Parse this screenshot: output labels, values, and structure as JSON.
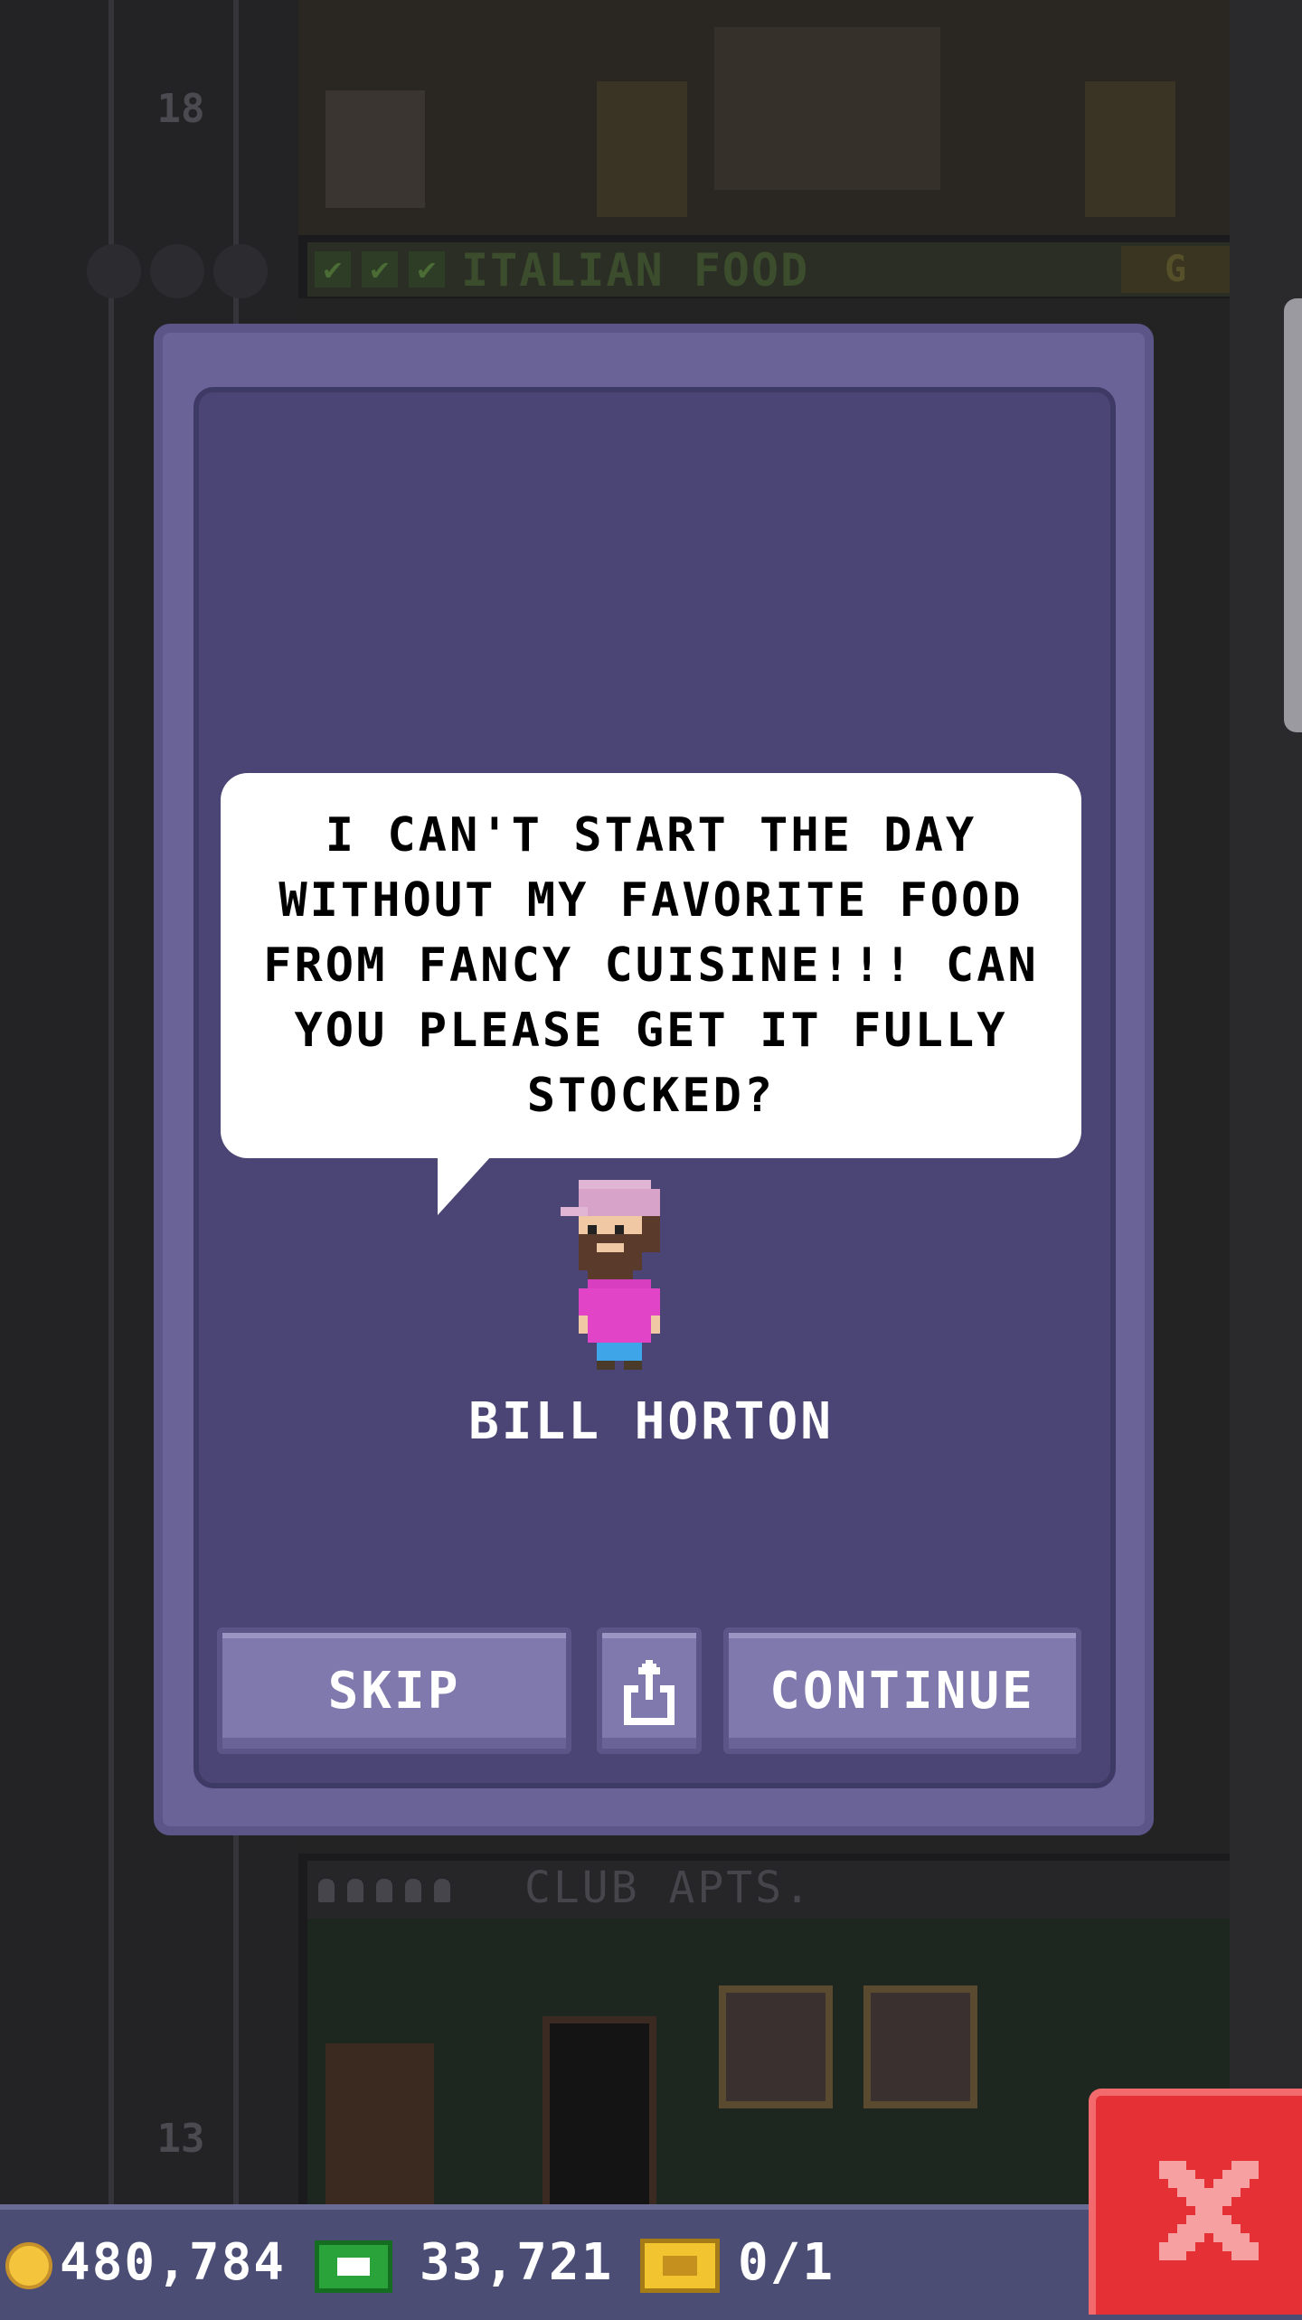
{
  "background": {
    "floor_numbers": [
      "18",
      "13"
    ],
    "top_floor_label": "ITALIAN FOOD",
    "top_floor_badge": "G",
    "bottom_floor_label": "CLUB APTS."
  },
  "dialog": {
    "message": "I CAN'T START THE DAY WITHOUT MY FAVORITE FOOD FROM FANCY CUISINE!!! CAN YOU PLEASE GET IT FULLY STOCKED?",
    "character_name": "BILL HORTON",
    "buttons": {
      "skip": "SKIP",
      "share_icon": "share-icon",
      "continue": "CONTINUE"
    }
  },
  "hud": {
    "coins": "480,784",
    "bux": "33,721",
    "tickets": "0/1"
  },
  "close_icon": "close-x-icon",
  "colors": {
    "modal": "#6a6397",
    "modal_inner": "#4a4574",
    "button": "#7f79ad",
    "hud": "#4b4d74",
    "close": "#e53035",
    "coin": "#f4c53c",
    "bux": "#2aa33a"
  }
}
